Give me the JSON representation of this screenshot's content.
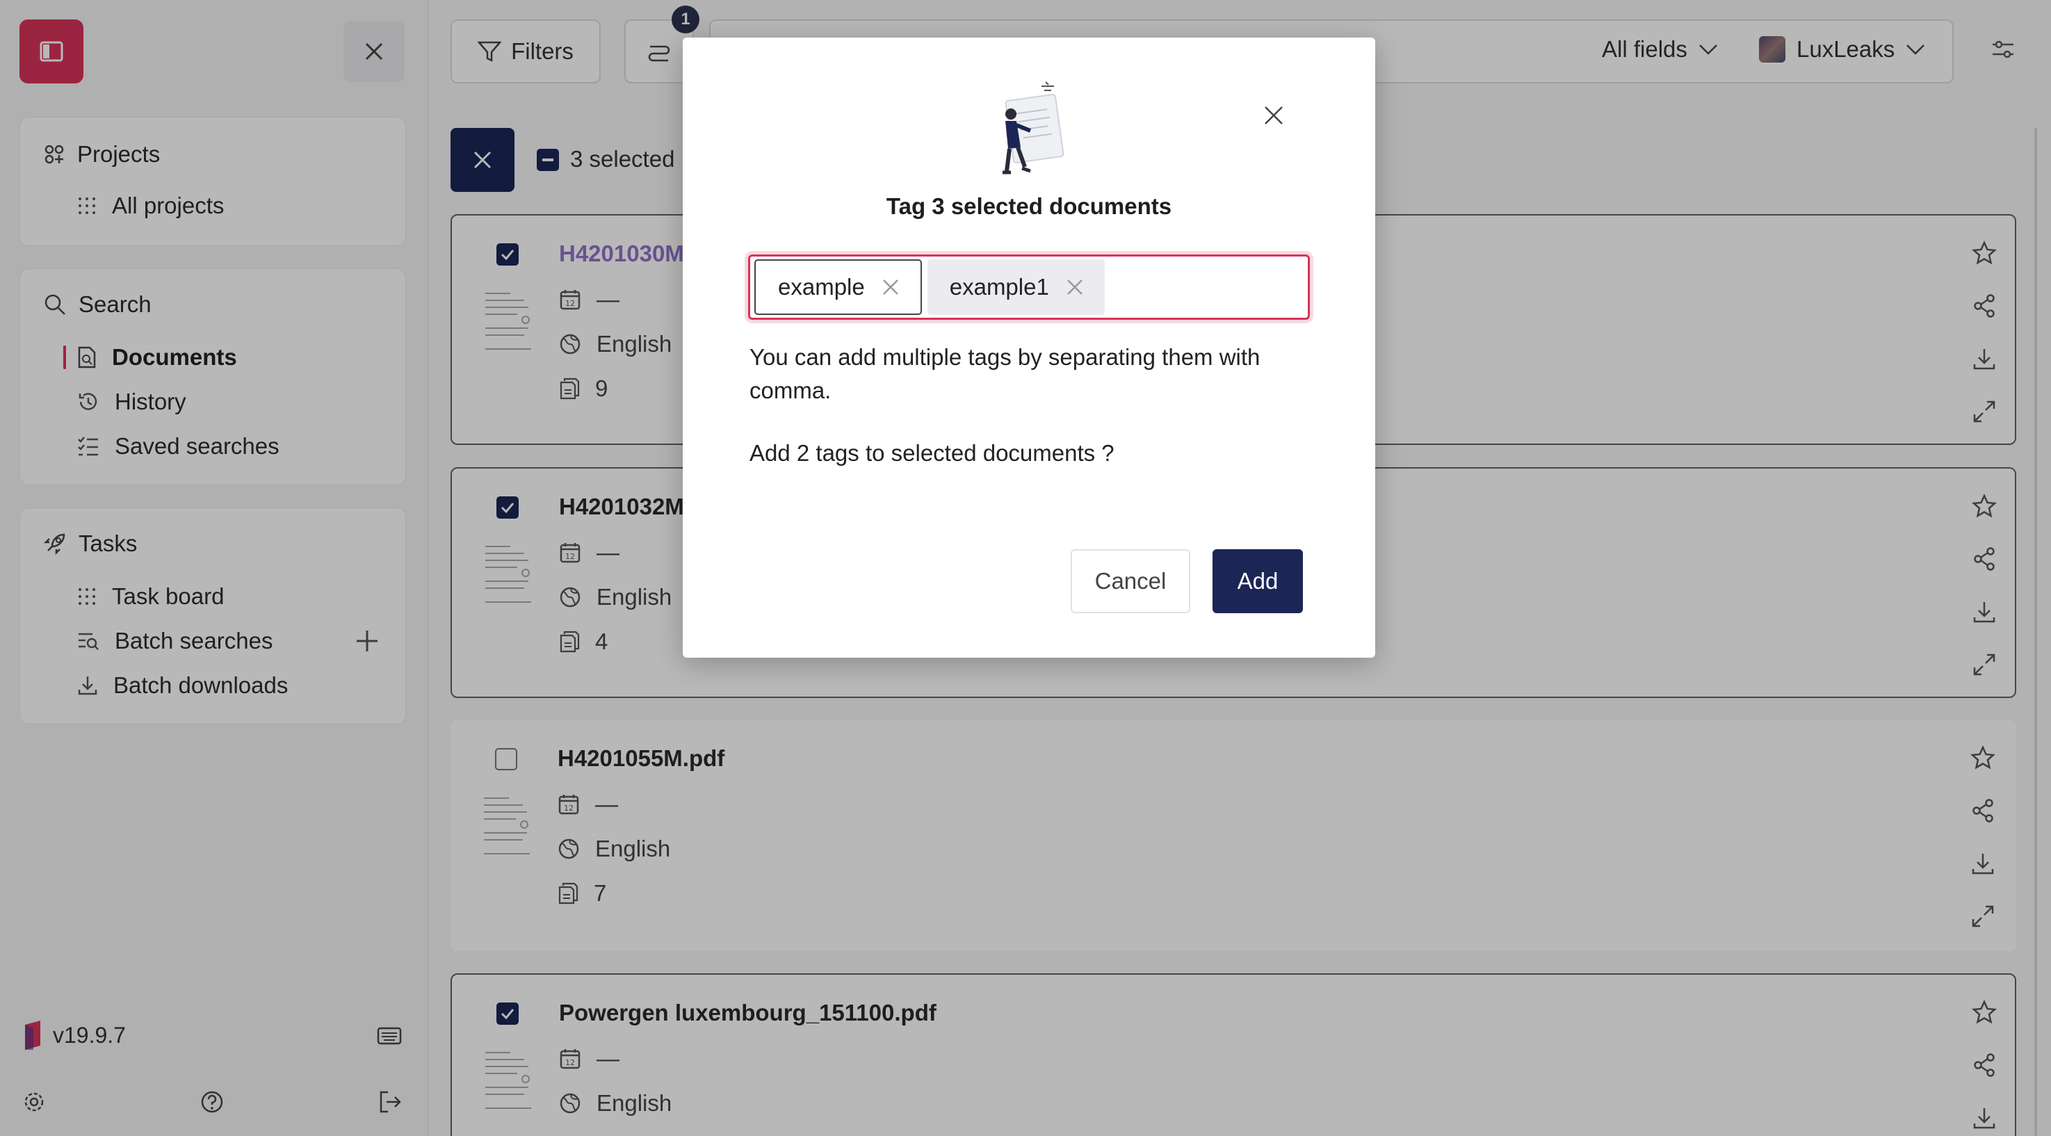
{
  "sidebar": {
    "projects": {
      "title": "Projects",
      "items": [
        {
          "label": "All projects",
          "icon": "dots-grid-icon"
        }
      ]
    },
    "search": {
      "title": "Search",
      "items": [
        {
          "label": "Documents",
          "icon": "document-search-icon",
          "active": true
        },
        {
          "label": "History",
          "icon": "history-icon"
        },
        {
          "label": "Saved searches",
          "icon": "list-checks-icon"
        }
      ]
    },
    "tasks": {
      "title": "Tasks",
      "items": [
        {
          "label": "Task board",
          "icon": "dots-grid-icon"
        },
        {
          "label": "Batch searches",
          "icon": "batch-search-icon"
        },
        {
          "label": "Batch downloads",
          "icon": "download-icon"
        }
      ]
    },
    "version": "v19.9.7"
  },
  "topbar": {
    "filters_label": "Filters",
    "badge_count": "1",
    "field_select": "All fields",
    "project_select": "LuxLeaks"
  },
  "selection": {
    "label": "3 selected"
  },
  "documents": [
    {
      "title": "H4201030M.pdf",
      "date": "—",
      "language": "English",
      "pages": "9",
      "selected": true
    },
    {
      "title": "H4201032M.pdf",
      "date": "—",
      "language": "English",
      "pages": "4",
      "selected": true
    },
    {
      "title": "H4201055M.pdf",
      "date": "—",
      "language": "English",
      "pages": "7",
      "selected": false
    },
    {
      "title": "Powergen luxembourg_151100.pdf",
      "date": "—",
      "language": "English",
      "pages": "",
      "selected": true
    }
  ],
  "modal": {
    "title": "Tag 3 selected documents",
    "tags": [
      "example",
      "example1"
    ],
    "hint": "You can add multiple tags by separating them with comma.",
    "confirm": "Add 2 tags to selected documents ?",
    "cancel_label": "Cancel",
    "add_label": "Add"
  },
  "colors": {
    "brand": "#d7325a",
    "primary": "#1b2656"
  }
}
